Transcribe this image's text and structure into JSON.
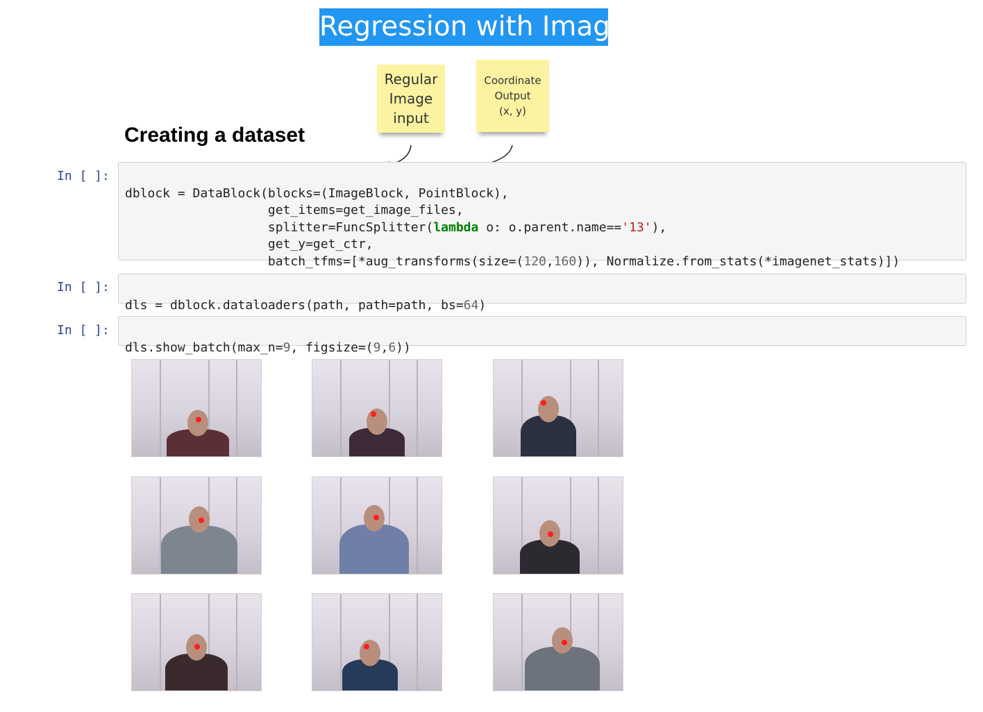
{
  "slide": {
    "title": "Regression with Images"
  },
  "notes": {
    "input": [
      "Regular",
      "Image",
      "input"
    ],
    "output": [
      "Coordinate",
      "Output",
      "(x, y)"
    ]
  },
  "notebook": {
    "heading": "Creating a dataset",
    "prompt": "In [ ]:",
    "cells": [
      {
        "lines": [
          "dblock = DataBlock(blocks=(ImageBlock, PointBlock),",
          "                   get_items=get_image_files,",
          "                   splitter=FuncSplitter(lambda o: o.parent.name=='13'),",
          "                   get_y=get_ctr,",
          "                   batch_tfms=[*aug_transforms(size=(120,160)), Normalize.from_stats(*imagenet_stats)])"
        ]
      },
      {
        "lines": [
          "dls = dblock.dataloaders(path, path=path, bs=64)"
        ]
      },
      {
        "lines": [
          "dls.show_batch(max_n=9, figsize=(9,6))"
        ]
      }
    ]
  },
  "batch": {
    "count": 9,
    "point_color": "#ff1e1e"
  }
}
